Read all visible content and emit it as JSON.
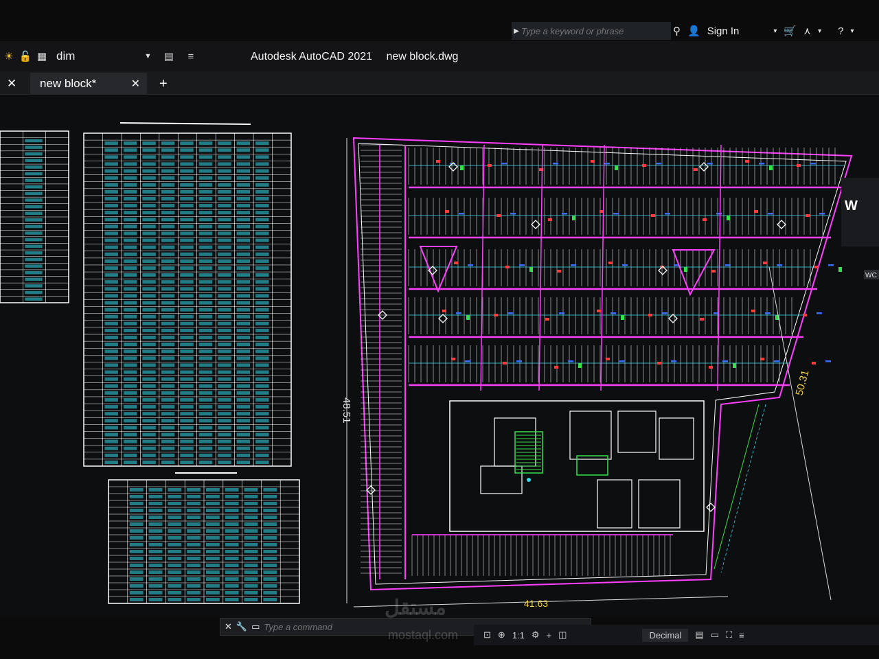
{
  "titlebar": {
    "workspace": "dim",
    "app_name": "Autodesk AutoCAD 2021",
    "file_name": "new block.dwg",
    "search_placeholder": "Type a keyword or phrase",
    "sign_in": "Sign In"
  },
  "tabs": {
    "document_tab": "new block*",
    "add_tab": "+"
  },
  "drawing": {
    "dim_left": "48.51",
    "dim_right": "50.31",
    "dim_bottom": "41.63",
    "view_cube_label": "W",
    "wcs_label": "WC"
  },
  "command_line": {
    "placeholder": "Type a command"
  },
  "statusbar": {
    "scale": "1:1",
    "units": "Decimal"
  },
  "watermark": {
    "line1": "مستقل",
    "line2": "mostaql.com"
  },
  "colors": {
    "wall": "#ff3fff",
    "grid": "#ffffff",
    "cyan": "#35d7e6",
    "red": "#ff3b3b",
    "green": "#36e04a",
    "blue": "#3c6dff"
  }
}
